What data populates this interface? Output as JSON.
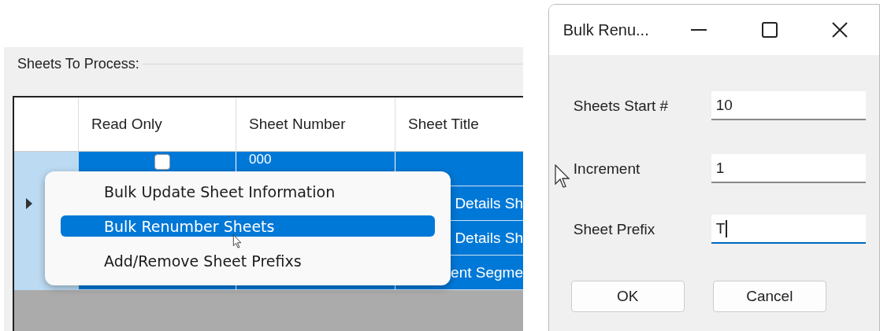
{
  "group_box": {
    "label": "Sheets To Process:"
  },
  "table": {
    "columns": [
      "Read Only",
      "Sheet Number",
      "Sheet Title"
    ],
    "rows": [
      {
        "selected": true,
        "current": false,
        "read_only": false,
        "sheet_number": "000"
      },
      {
        "selected": true,
        "current": true,
        "sheet_title": "Details Sh"
      },
      {
        "selected": true,
        "current": false,
        "sheet_title": "Details Sh"
      },
      {
        "selected": true,
        "current": false,
        "sheet_title": "ent Segme"
      }
    ]
  },
  "context_menu": {
    "items": [
      {
        "label": "Bulk Update Sheet Information",
        "selected": false
      },
      {
        "label": "Bulk Renumber Sheets",
        "selected": true
      },
      {
        "label": "Add/Remove Sheet Prefixs",
        "selected": false
      }
    ]
  },
  "dialog": {
    "title": "Bulk Renu...",
    "fields": [
      {
        "label": "Sheets Start #",
        "value": "10",
        "focused": false
      },
      {
        "label": "Increment",
        "value": "1",
        "focused": false
      },
      {
        "label": "Sheet Prefix",
        "value": "T",
        "focused": true
      }
    ],
    "buttons": [
      "OK",
      "Cancel"
    ]
  }
}
